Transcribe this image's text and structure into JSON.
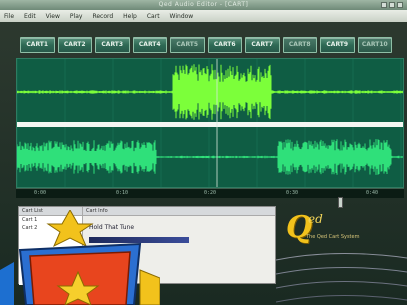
{
  "window": {
    "title": "Qed Audio Editor - [CART]"
  },
  "menu": {
    "items": [
      "File",
      "Edit",
      "View",
      "Play",
      "Record",
      "Help",
      "Cart",
      "Window"
    ]
  },
  "carts": [
    {
      "label": "CART1",
      "dim": false
    },
    {
      "label": "CART2",
      "dim": false
    },
    {
      "label": "CART3",
      "dim": false
    },
    {
      "label": "CART4",
      "dim": false
    },
    {
      "label": "CART5",
      "dim": true
    },
    {
      "label": "CART6",
      "dim": false
    },
    {
      "label": "CART7",
      "dim": false
    },
    {
      "label": "CART8",
      "dim": true
    },
    {
      "label": "CART9",
      "dim": false
    },
    {
      "label": "CART10",
      "dim": true
    }
  ],
  "timescale": {
    "labels": [
      "0:00",
      "0:10",
      "0:20",
      "0:30",
      "0:40"
    ]
  },
  "panel": {
    "left_header": "Cart List",
    "left_rows": [
      "Cart 1",
      "Cart 2"
    ],
    "right_header": "Cart Info",
    "field_text": "Hold That Tune"
  },
  "logo": {
    "letter": "Q",
    "suffix": "ed",
    "tagline": "The Qed Cart System"
  },
  "colors": {
    "wave_bg": "#0f5d44",
    "wave_fg": "#2fe07a",
    "wave_hi": "#7cff3a",
    "logo_gold": "#f2c21c"
  }
}
